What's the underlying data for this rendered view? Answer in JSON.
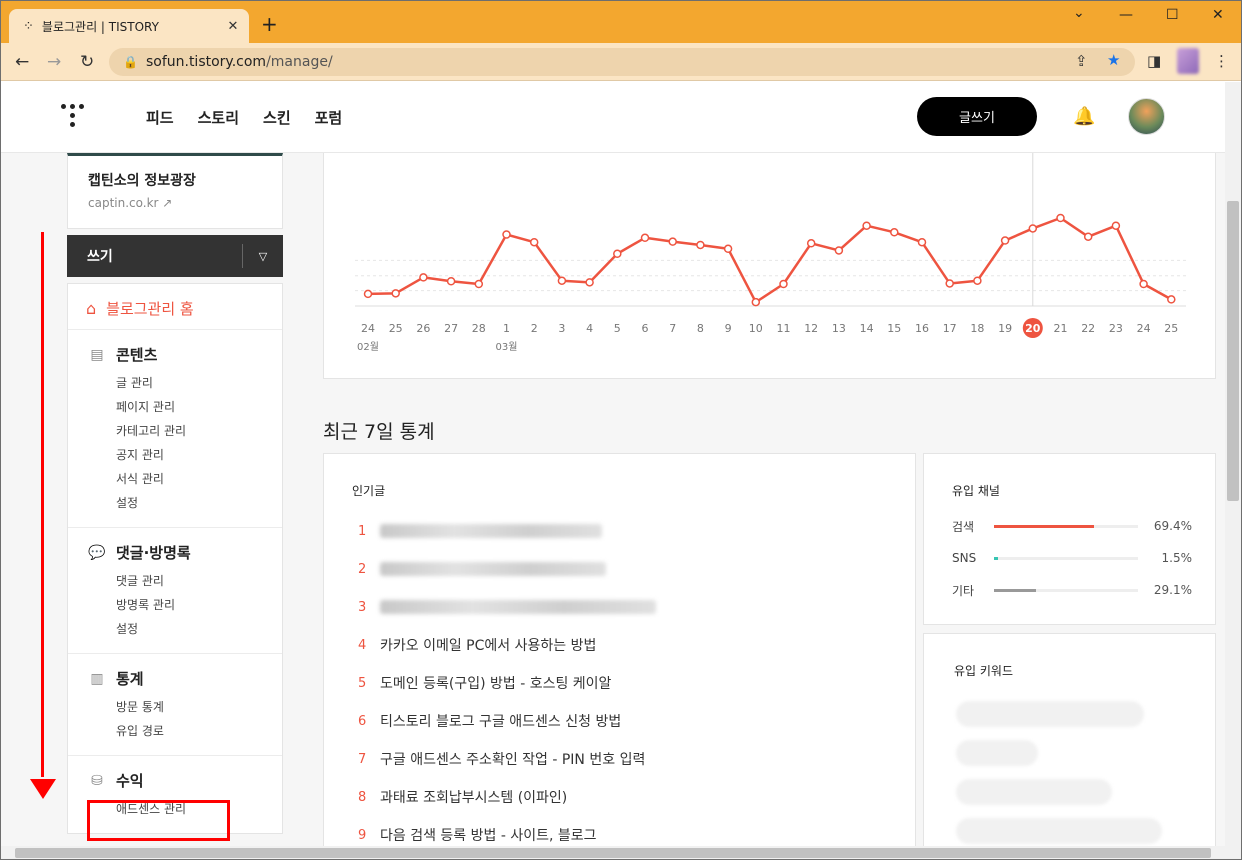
{
  "browser": {
    "tab_title": "블로그관리 | TISTORY",
    "url_host": "sofun.tistory.com",
    "url_path": "/manage/",
    "new_tab": "+",
    "minimize": "—",
    "maximize": "☐",
    "close": "✕",
    "chevron": "⌄"
  },
  "topnav": {
    "links": [
      "피드",
      "스토리",
      "스킨",
      "포럼"
    ],
    "write_button": "글쓰기"
  },
  "blog": {
    "name": "캡틴소의 정보광장",
    "url": "captin.co.kr"
  },
  "sidebar": {
    "write_label": "쓰기",
    "home_label": "블로그관리 홈",
    "sections": [
      {
        "title": "콘텐츠",
        "icon": "document-icon",
        "items": [
          "글 관리",
          "페이지 관리",
          "카테고리 관리",
          "공지 관리",
          "서식 관리",
          "설정"
        ]
      },
      {
        "title": "댓글·방명록",
        "icon": "comment-icon",
        "items": [
          "댓글 관리",
          "방명록 관리",
          "설정"
        ]
      },
      {
        "title": "통계",
        "icon": "bar-chart-icon",
        "items": [
          "방문 통계",
          "유입 경로"
        ]
      },
      {
        "title": "수익",
        "icon": "coins-icon",
        "items": [
          "애드센스 관리"
        ]
      }
    ]
  },
  "chart_data": {
    "type": "line",
    "x": [
      "24",
      "25",
      "26",
      "27",
      "28",
      "1",
      "2",
      "3",
      "4",
      "5",
      "6",
      "7",
      "8",
      "9",
      "10",
      "11",
      "12",
      "13",
      "14",
      "15",
      "16",
      "17",
      "18",
      "19",
      "20",
      "21",
      "22",
      "23",
      "24",
      "25"
    ],
    "month_labels": [
      {
        "index": 0,
        "label": "02월"
      },
      {
        "index": 5,
        "label": "03월"
      }
    ],
    "highlight_index": 24,
    "series": [
      {
        "values": [
          22,
          23,
          52,
          45,
          40,
          130,
          116,
          46,
          43,
          95,
          124,
          117,
          111,
          104,
          7,
          40,
          114,
          101,
          146,
          134,
          116,
          41,
          46,
          119,
          141,
          160,
          126,
          146,
          40,
          12
        ]
      }
    ],
    "ylim": [
      0,
      200
    ],
    "grid": true,
    "color": "#ee5440"
  },
  "stats": {
    "title": "최근 7일 통계",
    "popular_title": "인기글",
    "popular": [
      {
        "rank": "1",
        "title": "",
        "blurred": true
      },
      {
        "rank": "2",
        "title": "",
        "blurred": true
      },
      {
        "rank": "3",
        "title": "",
        "blurred": true
      },
      {
        "rank": "4",
        "title": "카카오 이메일 PC에서 사용하는 방법",
        "blurred": false
      },
      {
        "rank": "5",
        "title": "도메인 등록(구입) 방법 - 호스팅 케이알",
        "blurred": false
      },
      {
        "rank": "6",
        "title": "티스토리 블로그 구글 애드센스 신청 방법",
        "blurred": false
      },
      {
        "rank": "7",
        "title": "구글 애드센스 주소확인 작업 - PIN 번호 입력",
        "blurred": false
      },
      {
        "rank": "8",
        "title": "과태료 조회납부시스템 (이파인)",
        "blurred": false
      },
      {
        "rank": "9",
        "title": "다음 검색 등록 방법 - 사이트, 블로그",
        "blurred": false
      }
    ],
    "channel_title": "유입 채널",
    "channels": [
      {
        "name": "검색",
        "value": 69.4,
        "label": "69.4%",
        "color": "#ee5440"
      },
      {
        "name": "SNS",
        "value": 1.5,
        "label": "1.5%",
        "color": "#36c5b2"
      },
      {
        "name": "기타",
        "value": 29.1,
        "label": "29.1%",
        "color": "#999999"
      }
    ],
    "keywords_title": "유입 키워드"
  }
}
